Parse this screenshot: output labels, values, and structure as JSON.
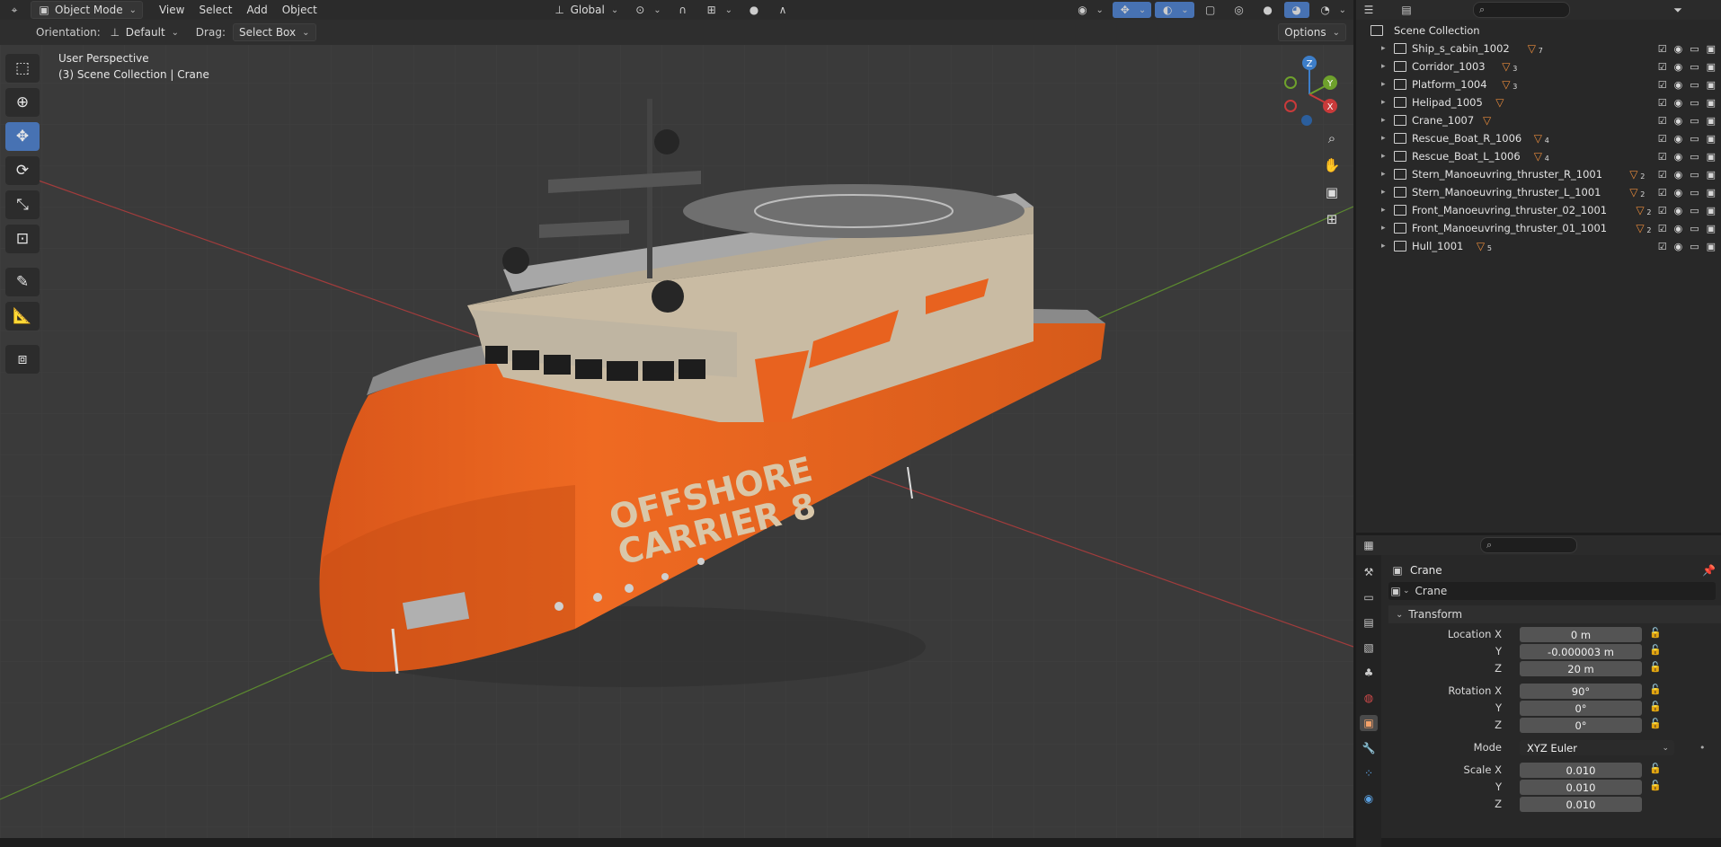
{
  "header": {
    "mode": "Object Mode",
    "menu": [
      "View",
      "Select",
      "Add",
      "Object"
    ],
    "transform_orientation": "Global"
  },
  "subheader": {
    "orientation_label": "Orientation:",
    "orientation_value": "Default",
    "drag_label": "Drag:",
    "drag_value": "Select Box",
    "options": "Options"
  },
  "viewport": {
    "perspective": "User Perspective",
    "collection_info": "(3) Scene Collection | Crane",
    "ship_text_line1": "OFFSHORE",
    "ship_text_line2": "CARRIER 8",
    "colors": {
      "hull": "#e8621f",
      "superstructure": "#c9bba3",
      "background": "#3a3a3a"
    }
  },
  "gizmo": {
    "x": "X",
    "y": "Y",
    "z": "Z"
  },
  "outliner": {
    "root": "Scene Collection",
    "items": [
      {
        "name": "Ship_s_cabin_1002",
        "count": "7"
      },
      {
        "name": "Corridor_1003",
        "count": "3"
      },
      {
        "name": "Platform_1004",
        "count": "3"
      },
      {
        "name": "Helipad_1005",
        "count": ""
      },
      {
        "name": "Crane_1007",
        "count": ""
      },
      {
        "name": "Rescue_Boat_R_1006",
        "count": "4"
      },
      {
        "name": "Rescue_Boat_L_1006",
        "count": "4"
      },
      {
        "name": "Stern_Manoeuvring_thruster_R_1001",
        "count": "2"
      },
      {
        "name": "Stern_Manoeuvring_thruster_L_1001",
        "count": "2"
      },
      {
        "name": "Front_Manoeuvring_thruster_02_1001",
        "count": "2"
      },
      {
        "name": "Front_Manoeuvring_thruster_01_1001",
        "count": "2"
      },
      {
        "name": "Hull_1001",
        "count": "5"
      }
    ]
  },
  "properties": {
    "object_name": "Crane",
    "data_name": "Crane",
    "panel": "Transform",
    "location": {
      "label": "Location X",
      "x": "0 m",
      "y": "-0.000003 m",
      "z": "20 m"
    },
    "rotation": {
      "label": "Rotation X",
      "x": "90°",
      "y": "0°",
      "z": "0°"
    },
    "mode_label": "Mode",
    "mode_value": "XYZ Euler",
    "scale": {
      "label": "Scale X",
      "x": "0.010",
      "y": "0.010",
      "z": "0.010"
    },
    "axis_y": "Y",
    "axis_z": "Z"
  }
}
